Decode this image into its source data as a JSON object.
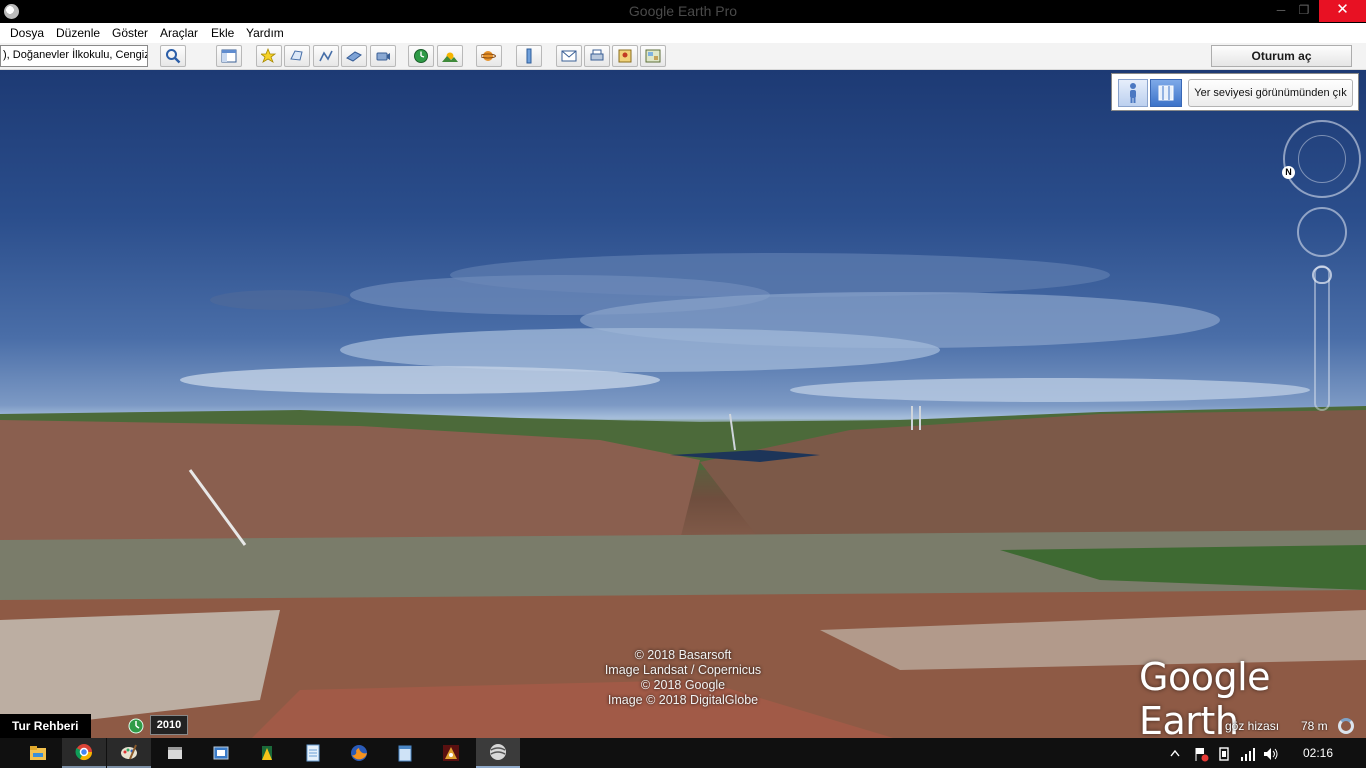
{
  "window": {
    "title": "Google Earth Pro",
    "close_label": "✕",
    "minimize_label": "─",
    "maximize_label": "❐"
  },
  "menu": [
    "Dosya",
    "Düzenle",
    "Göster",
    "Araçlar",
    "Ekle",
    "Yardım"
  ],
  "toolbar": {
    "search_value": "), Doğanevler İlkokulu, Cengiz Topel",
    "signin_label": "Oturum aç",
    "buttons": [
      "search-icon",
      "sidebar-icon",
      "placemark-icon",
      "polygon-icon",
      "path-icon",
      "image-overlay-icon",
      "record-tour-icon",
      "historical-imagery-icon",
      "sunlight-icon",
      "planets-icon",
      "ruler-icon",
      "email-icon",
      "print-icon",
      "save-image-icon",
      "view-in-maps-icon"
    ]
  },
  "ground_view": {
    "exit_label": "Yer seviyesi görünümünden çık"
  },
  "navigation": {
    "north_label": "N"
  },
  "attribution": {
    "line1": "© 2018 Basarsoft",
    "line2": "Image Landsat / Copernicus",
    "line3": "© 2018 Google",
    "line4": "Image © 2018 DigitalGlobe"
  },
  "logo_text": "Google Earth",
  "status": {
    "tour_label": "Tur Rehberi",
    "year": "2010",
    "eye_level_label": "göz hizası",
    "altitude": "78 m"
  },
  "taskbar": {
    "apps": [
      "file-explorer-icon",
      "chrome-icon",
      "paint-icon",
      "app-window-icon",
      "task-window-icon",
      "visual-icon",
      "notepad-icon",
      "firefox-icon",
      "notes-icon",
      "game-icon",
      "google-earth-icon"
    ],
    "clock": "02:16"
  },
  "colors": {
    "close_button": "#e81123",
    "sky_top": "#1d3a74",
    "rooftops": "#a0705c"
  }
}
